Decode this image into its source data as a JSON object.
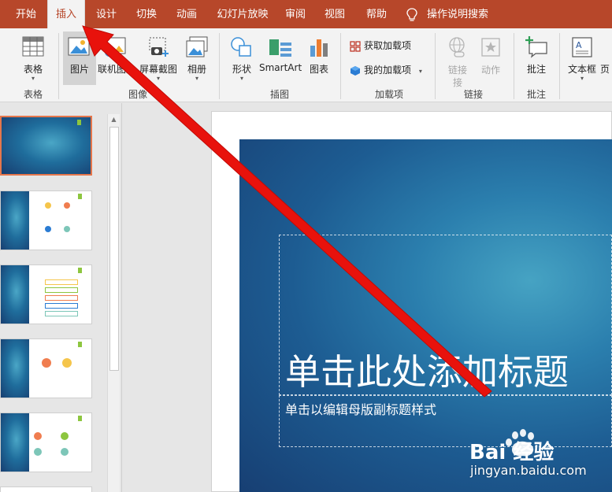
{
  "tabs": [
    {
      "label": "开始"
    },
    {
      "label": "插入"
    },
    {
      "label": "设计"
    },
    {
      "label": "切换"
    },
    {
      "label": "动画"
    },
    {
      "label": "幻灯片放映"
    },
    {
      "label": "审阅"
    },
    {
      "label": "视图"
    },
    {
      "label": "帮助"
    }
  ],
  "tell_me": "操作说明搜索",
  "ribbon": {
    "table": "表格",
    "picture": "图片",
    "online_picture": "联机图片",
    "screenshot": "屏幕截图",
    "album": "相册",
    "shapes": "形状",
    "smartart": "SmartArt",
    "chart": "图表",
    "get_addins": "获取加载项",
    "my_addins": "我的加载项",
    "link": "链接",
    "action": "动作",
    "comment": "批注",
    "textbox": "文本框",
    "header_footer": "页",
    "groups": {
      "tables": "表格",
      "images": "图像",
      "illustrations": "插图",
      "addins": "加载项",
      "links": "链接",
      "comments": "批注"
    }
  },
  "slide": {
    "title_placeholder": "单击此处添加标题",
    "subtitle_placeholder": "单击以编辑母版副标题样式"
  },
  "watermark": {
    "brand": "Bai 经验",
    "url": "jingyan.baidu.com"
  },
  "colors": {
    "accent": "#b7472a",
    "arrow": "#e8120c",
    "selected_thumb_border": "#e5764b"
  }
}
